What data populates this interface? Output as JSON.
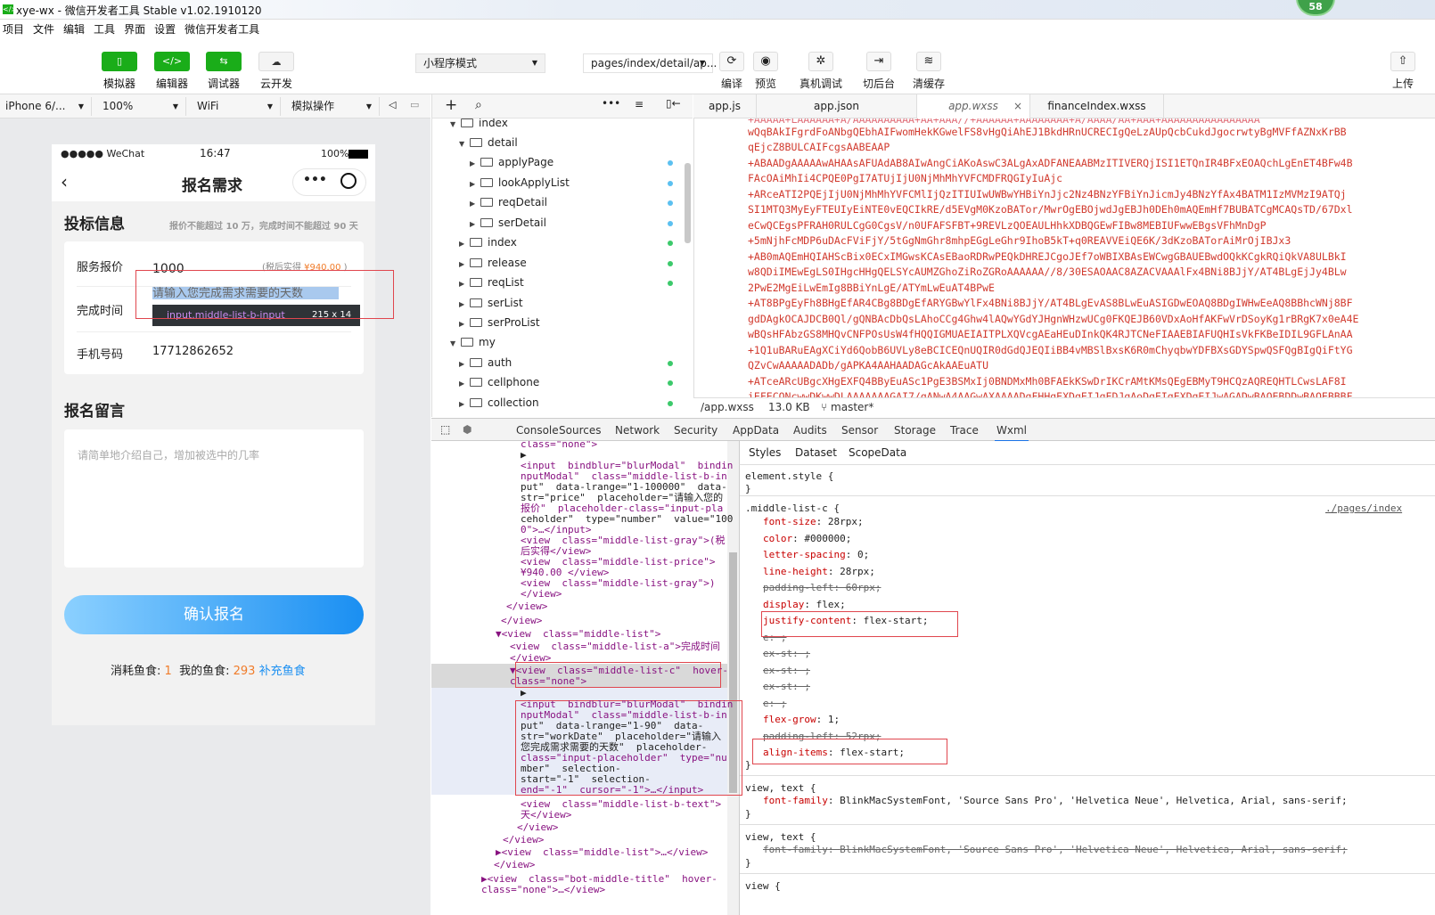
{
  "window": {
    "title": "xye-wx - 微信开发者工具 Stable v1.02.1910120",
    "badge": "58"
  },
  "menu": [
    "项目",
    "文件",
    "编辑",
    "工具",
    "界面",
    "设置",
    "微信开发者工具"
  ],
  "toolbar": {
    "simulator": "模拟器",
    "editor": "编辑器",
    "debugger": "调试器",
    "cloud": "云开发",
    "mode": "小程序模式",
    "page": "pages/index/detail/ap...",
    "compile": "编译",
    "preview": "预览",
    "real_debug": "真机调试",
    "background": "切后台",
    "clear_cache": "清缓存",
    "upload": "上传"
  },
  "simbar": {
    "device": "iPhone 6/...",
    "zoom": "100%",
    "network": "WiFi",
    "op": "模拟操作"
  },
  "phone": {
    "carrier": "●●●●● WeChat",
    "time": "16:47",
    "battery": "100%",
    "nav_title": "报名需求",
    "section1": "投标信息",
    "section1_hint": "报价不能超过 10 万，完成时间不能超过 90 天",
    "price_label": "服务报价",
    "price_value": "1000",
    "price_note_pre": "(税后实得",
    "price_note_val": "¥940.00",
    "price_note_post": ")",
    "time_label": "完成时间",
    "time_placeholder": "请输入您完成需求需要的天数",
    "tooltip_name": "input.middle-list-b-input",
    "tooltip_size": "215 x 14",
    "phone_label": "手机号码",
    "phone_value": "17712862652",
    "section2": "报名留言",
    "message_placeholder": "请简单地介绍自己，增加被选中的几率",
    "confirm": "确认报名",
    "cost_label": "消耗鱼食:",
    "cost_value": "1",
    "mine_label": "我的鱼食:",
    "mine_value": "293",
    "recharge": "补充鱼食"
  },
  "tree": [
    {
      "label": "index",
      "open": true
    },
    {
      "label": "detail",
      "open": true
    },
    {
      "label": "applyPage",
      "open": false,
      "dot": "blue"
    },
    {
      "label": "lookApplyList",
      "open": false,
      "dot": "blue"
    },
    {
      "label": "reqDetail",
      "open": false,
      "dot": "blue"
    },
    {
      "label": "serDetail",
      "open": false,
      "dot": "blue"
    },
    {
      "label": "index",
      "open": false,
      "dot": "green"
    },
    {
      "label": "release",
      "open": false,
      "dot": "green"
    },
    {
      "label": "reqList",
      "open": false,
      "dot": "green"
    },
    {
      "label": "serList",
      "open": false
    },
    {
      "label": "serProList",
      "open": false
    },
    {
      "label": "my",
      "open": true
    },
    {
      "label": "auth",
      "open": false,
      "dot": "green"
    },
    {
      "label": "cellphone",
      "open": false,
      "dot": "green"
    },
    {
      "label": "collection",
      "open": false,
      "dot": "green"
    }
  ],
  "editor": {
    "tabs": [
      "app.js",
      "app.json",
      "app.wxss",
      "financeIndex.wxss"
    ],
    "active_tab": "app.wxss",
    "lines": [
      "wQqBAkIFgrdFoANbgQEbhAIFwomHekKGwelFS8vHgQiAhEJ1BkdHRnUCRECIgQeLzAUpQcbCukdJgocrwtyBgMVFfAZNxKrBB",
      "qEjcZ8BULCAIFcgsAABEAAP",
      "+ABAADgAAAAAwAHAAsAFUAdAB8AIwAngCiAKoAswC3ALgAxADFANEAABMzITIVERQjISI1ETQnIR4BFxEOAQchLgEnET4BFw4B",
      "FAcOAiMhIi4CPQE0PgI7ATUjIjU0NjMhMhYVFCMDFRQGIyIuAjc",
      "+ARceATI2PQEjIjU0NjMhMhYVFCMlIjQzITIUIwUWBwYHBiYnJjc2Nz4BNzYFBiYnJicmJy4BNzYfAx4BATM1IzMVMzI9ATQj",
      "SI1MTQ3MyEyFTEUIyEiNTE0vEQCIkRE/d5EVgM0KzoBATor/MwrOgEBOjwdJgEBJh0DEh0mAQEmHf7BUBATCgMCAQsTD/67Dxl",
      "eCwQCEgsPFRAH0RULCgG0CgsV/n0UFAFSFBT+9REVLzQOEAULHhkXDBQGEwFIBw8MEBIUFwwEBgsVFhMnDgP",
      "+5mNjhFcMDP6uDAcFViFjY/5tGgNmGhr8mhpEGgLeGhr9IhoB5kT+q0REAVVEiQE6K/3dKzoBATorAiMrOjIBJx3",
      "+AB0mAQEmHQIAHScBix0ECxIMGwsKCAsEBaoRDRwPEQkDHREJCgoJEf7oWBIXBAsEWCwgGBAUEBwdOQkKCgkRQiQkVA8ULBkI",
      "w8QDiIMEwEgLS0IHgcHHgQELSYcAUMZGhoZiRoZGRoAAAAAA//8/30ESAOAAC8AZACVAAAlFx4BNi8BJjY/AT4BLgEjJy4BLw",
      "2PwE2MgEiLwEmIg8BBiYnLgE/ATYmLwEuAT4BPwE",
      "+AT8BPgEyFh8BHgEfAR4CBg8BDgEfARYGBwYlFx4BNi8BJjY/AT4BLgEvAS8BLwEuASIGDwEOAQ8BDgIWHwEeAQ8BBhcWNj8BF",
      "gdDAgkOCAJDCB0Ql/gQNBAcDbQsLAhoCCg4Ghw4lAQwYGdYJHgnWHzwUCg0FKQEJB60VDxAoHfAKFwVrDSoyKg1rBRgK7x0eA4E",
      "wBQsHFAbzGS8MHQvCNFPOsUsW4fHQQIGMUAEIAITPLXQVcgAEaHEuDInkQK4RJTCNeFIAAEBIAFUQHIsVkFKBeIDIL9GFLAnAA",
      "+1Q1uBARuEAgXCiYd6QobB6UVLy8eBCICEQnUQIR0dGdQJEQIiBB4vMBSlBxsK6R0mChyqbwYDFBXsGDYSpwQSFQgBIgQiFtYG",
      "QZvCwAAAAADADb/gAPKA4AAHAADAGcAkAAEuATU",
      "+ATceARcUBgcXHgEXFQ4BByEuASc1PgE3BSMxIj0BNDMxMh0BFAEkKSwDrIKCrAMtKMsQEgEBMyT9HCQzAQREQHTLCwsLAF8I",
      "iEFECQNcwwDKwwDLAAAAAAAGAI7/gANwA4AAGwAXAAAADgFHHgEXDgEIJgEDJgAoDgEIgEXDgEIJwAGADwBAOEBDDwBAOEBBBF"
    ],
    "status_file": "/app.wxss",
    "status_size": "13.0 KB",
    "status_branch": "master*"
  },
  "devtools": {
    "tabs": [
      "Console",
      "Sources",
      "Network",
      "Security",
      "AppData",
      "Audits",
      "Sensor",
      "Storage",
      "Trace",
      "Wxml"
    ],
    "active": "Wxml",
    "style_tabs": [
      "Styles",
      "Dataset",
      "ScopeData"
    ],
    "wxml_lines": [
      "  class=\"none\">",
      "  ▶",
      "  <input  bindblur=\"blurModal\"  bindin",
      "  nputModal\"  class=\"middle-list-b-in",
      "  put\"  data-lrange=\"1-100000\"  data-",
      "  str=\"price\"  placeholder=\"请输入您的",
      "  报价\"  placeholder-class=\"input-pla",
      "  ceholder\"  type=\"number\"  value=\"100",
      "  0\">…</input>",
      "  <view  class=\"middle-list-gray\">(税",
      "  后实得</view>",
      "  <view  class=\"middle-list-price\">",
      "  ¥940.00 </view>",
      "  <view  class=\"middle-list-gray\">)",
      "  </view>",
      " </view>",
      "</view>",
      "▼<view  class=\"middle-list\">",
      "  <view  class=\"middle-list-a\">完成时间",
      "  </view>",
      " ▼<view  class=\"middle-list-c\"  hover-",
      "  class=\"none\">",
      "  ▶",
      "  <input  bindblur=\"blurModal\"  bindin",
      "  nputModal\"  class=\"middle-list-b-in",
      "  put\"  data-lrange=\"1-90\"  data-",
      "  str=\"workDate\"  placeholder=\"请输入",
      "  您完成需求需要的天数\"  placeholder-",
      "  class=\"input-placeholder\"  type=\"nu",
      "  mber\"  selection-",
      "  start=\"-1\"  selection-",
      "  end=\"-1\"  cursor=\"-1\">…</input>",
      "  <view  class=\"middle-list-b-text\">",
      "  天</view>",
      " </view>",
      "</view>",
      "▶<view  class=\"middle-list\">…</view>",
      "</view>",
      "▶<view  class=\"bot-middle-title\"  hover-",
      "class=\"none\">…</view>"
    ],
    "styles": {
      "element_style": "element.style {",
      "rule_selector": ".middle-list-c {",
      "rule_source": "./pages/index",
      "props": [
        {
          "name": "font-size",
          "value": "28rpx;",
          "strike": false
        },
        {
          "name": "color",
          "value": "#000000;",
          "strike": false
        },
        {
          "name": "letter-spacing",
          "value": "0;",
          "strike": false
        },
        {
          "name": "line-height",
          "value": "28rpx;",
          "strike": false
        },
        {
          "name": "padding-left",
          "value": "60rpx;",
          "strike": true
        },
        {
          "name": "display",
          "value": "flex;",
          "strike": false
        },
        {
          "name": "justify-content",
          "value": "flex-start;",
          "strike": false
        },
        {
          "name": "e",
          "value": ";",
          "strike": true
        },
        {
          "name": "ex-st",
          "value": ";",
          "strike": true
        },
        {
          "name": "ex-st",
          "value": ";",
          "strike": true
        },
        {
          "name": "ex-st",
          "value": ";",
          "strike": true
        },
        {
          "name": "e",
          "value": ";",
          "strike": true
        },
        {
          "name": "flex-grow",
          "value": "1;",
          "strike": false
        },
        {
          "name": "padding-left",
          "value": "52rpx;",
          "strike": true
        },
        {
          "name": "align-items",
          "value": "flex-start;",
          "strike": false
        }
      ],
      "view_text1": "view, text {",
      "ff_prop": "font-family",
      "ff_value": "BlinkMacSystemFont, 'Source Sans Pro', 'Helvetica Neue', Helvetica, Arial, sans-serif;",
      "view_text2": "view, text {",
      "view_last": "view {"
    }
  },
  "colors": {
    "green": "#1aad19",
    "blue": "#1a8ff2",
    "dot_blue": "#5bc0f0",
    "dot_green": "#3cc96b",
    "orange": "#f07c2a",
    "red": "#e0464e"
  }
}
